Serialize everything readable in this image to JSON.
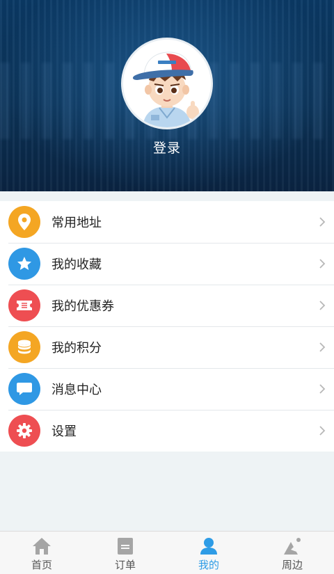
{
  "header": {
    "login_label": "登录"
  },
  "menu": {
    "items": [
      {
        "label": "常用地址",
        "icon": "location-pin-icon",
        "color": "#f4a623"
      },
      {
        "label": "我的收藏",
        "icon": "star-icon",
        "color": "#2f98e4"
      },
      {
        "label": "我的优惠券",
        "icon": "ticket-icon",
        "color": "#ee4e52"
      },
      {
        "label": "我的积分",
        "icon": "coin-stack-icon",
        "color": "#f4a623"
      },
      {
        "label": "消息中心",
        "icon": "chat-bubble-icon",
        "color": "#2f98e4"
      },
      {
        "label": "设置",
        "icon": "gear-icon",
        "color": "#ee4e52"
      }
    ]
  },
  "tabbar": {
    "tabs": [
      {
        "label": "首页",
        "icon": "home-icon",
        "active": false
      },
      {
        "label": "订单",
        "icon": "order-icon",
        "active": false
      },
      {
        "label": "我的",
        "icon": "user-icon",
        "active": true
      },
      {
        "label": "周边",
        "icon": "nearby-icon",
        "active": false
      }
    ],
    "active_color": "#2e9ce6",
    "inactive_color": "#999999"
  }
}
